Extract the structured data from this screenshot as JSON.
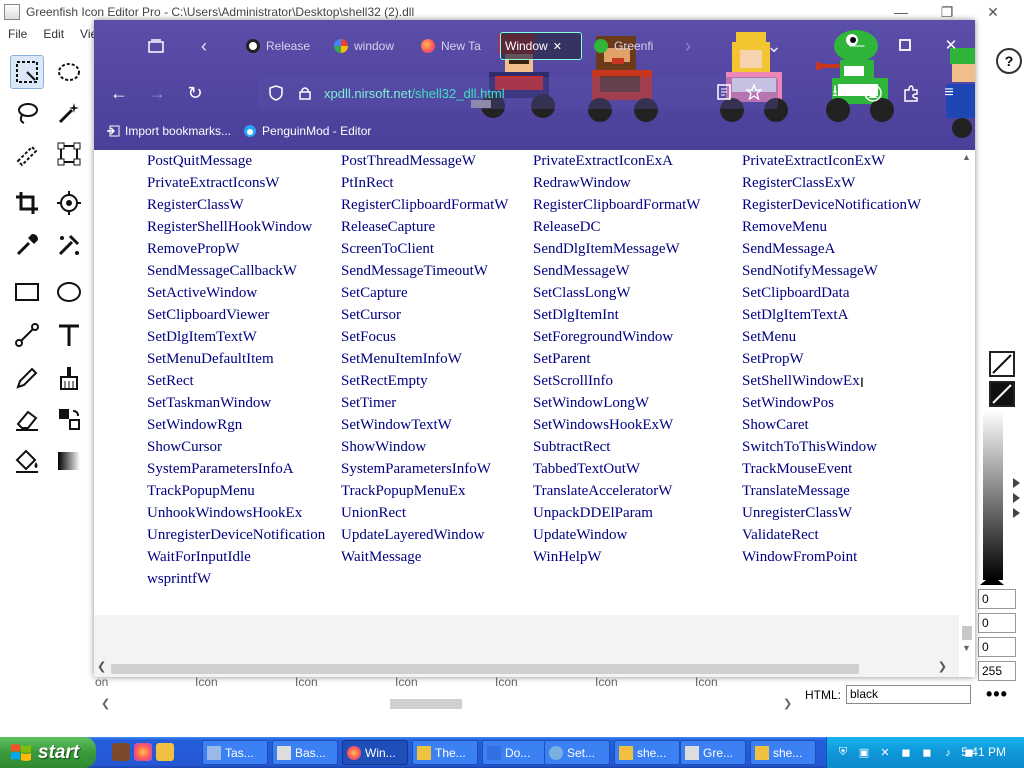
{
  "greenfish": {
    "title": "Greenfish Icon Editor Pro - C:\\Users\\Administrator\\Desktop\\shell32 (2).dll",
    "menu": [
      "File",
      "Edit",
      "View"
    ],
    "icon_labels": [
      "on",
      "Icon",
      "Icon",
      "Icon",
      "Icon",
      "Icon",
      "Icon"
    ],
    "html_label": "HTML:",
    "html_value": "black",
    "rgba_values": [
      "0",
      "0",
      "0",
      "255"
    ]
  },
  "firefox": {
    "tabs": [
      {
        "label": "Release"
      },
      {
        "label": "window"
      },
      {
        "label": "New Ta"
      },
      {
        "label": "Window"
      },
      {
        "label": "Greenfi"
      }
    ],
    "url": "xpdll.nirsoft.net/shell32_dll.html",
    "url_domain": "xpdll.nirsoft.net",
    "url_path": "/shell32_dll.html",
    "bookmarks": [
      {
        "label": "Import bookmarks..."
      },
      {
        "label": "PenguinMod - Editor"
      }
    ]
  },
  "page": {
    "functions": [
      [
        "PostQuitMessage",
        "PostThreadMessageW",
        "PrivateExtractIconExA",
        "PrivateExtractIconExW"
      ],
      [
        "PrivateExtractIconsW",
        "PtInRect",
        "RedrawWindow",
        "RegisterClassExW"
      ],
      [
        "RegisterClassW",
        "RegisterClipboardFormatW",
        "RegisterClipboardFormatW",
        "RegisterDeviceNotificationW"
      ],
      [
        "RegisterShellHookWindow",
        "ReleaseCapture",
        "ReleaseDC",
        "RemoveMenu"
      ],
      [
        "RemovePropW",
        "ScreenToClient",
        "SendDlgItemMessageW",
        "SendMessageA"
      ],
      [
        "SendMessageCallbackW",
        "SendMessageTimeoutW",
        "SendMessageW",
        "SendNotifyMessageW"
      ],
      [
        "SetActiveWindow",
        "SetCapture",
        "SetClassLongW",
        "SetClipboardData"
      ],
      [
        "SetClipboardViewer",
        "SetCursor",
        "SetDlgItemInt",
        "SetDlgItemTextA"
      ],
      [
        "SetDlgItemTextW",
        "SetFocus",
        "SetForegroundWindow",
        "SetMenu"
      ],
      [
        "SetMenuDefaultItem",
        "SetMenuItemInfoW",
        "SetParent",
        "SetPropW"
      ],
      [
        "SetRect",
        "SetRectEmpty",
        "SetScrollInfo",
        "SetShellWindowEx"
      ],
      [
        "SetTaskmanWindow",
        "SetTimer",
        "SetWindowLongW",
        "SetWindowPos"
      ],
      [
        "SetWindowRgn",
        "SetWindowTextW",
        "SetWindowsHookExW",
        "ShowCaret"
      ],
      [
        "ShowCursor",
        "ShowWindow",
        "SubtractRect",
        "SwitchToThisWindow"
      ],
      [
        "SystemParametersInfoA",
        "SystemParametersInfoW",
        "TabbedTextOutW",
        "TrackMouseEvent"
      ],
      [
        "TrackPopupMenu",
        "TrackPopupMenuEx",
        "TranslateAcceleratorW",
        "TranslateMessage"
      ],
      [
        "UnhookWindowsHookEx",
        "UnionRect",
        "UnpackDDElParam",
        "UnregisterClassW"
      ],
      [
        "UnregisterDeviceNotification",
        "UpdateLayeredWindow",
        "UpdateWindow",
        "ValidateRect"
      ],
      [
        "WaitForInputIdle",
        "WaitMessage",
        "WinHelpW",
        "WindowFromPoint"
      ],
      [
        "wsprintfW",
        "",
        "",
        ""
      ]
    ]
  },
  "taskbar": {
    "start_label": "start",
    "tasks": [
      {
        "label": "Tas..."
      },
      {
        "label": "Bas..."
      },
      {
        "label": "Win..."
      },
      {
        "label": "The..."
      },
      {
        "label": "Do..."
      },
      {
        "label": "Set..."
      },
      {
        "label": "she..."
      },
      {
        "label": "Gre..."
      },
      {
        "label": "she..."
      }
    ],
    "clock": "5:41 PM"
  },
  "colors": {
    "ff_chrome": "#4a3f99",
    "url_text": "#3fe0c0",
    "link_text": "#000080",
    "taskbar": "#245edb",
    "start": "#3a9a3a",
    "systray": "#0f97d8"
  }
}
